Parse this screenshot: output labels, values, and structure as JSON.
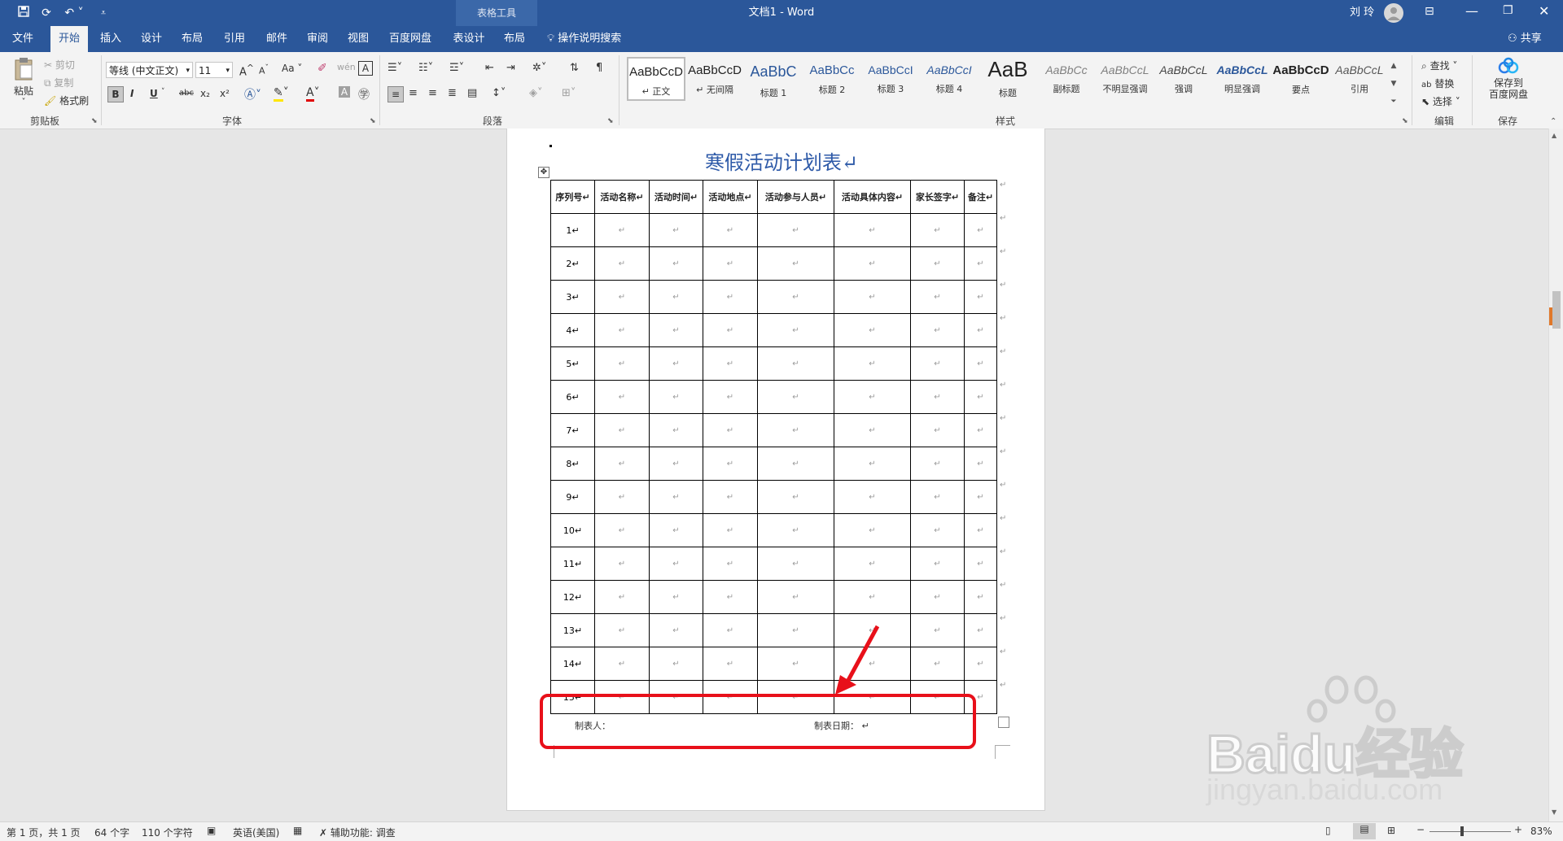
{
  "titlebar": {
    "context_tool": "表格工具",
    "doc_title": "文档1  -  Word",
    "user": "刘 玲",
    "qat": {
      "save_icon": "save-icon",
      "redo_icon": "redo-icon",
      "undo_icon": "undo-icon",
      "customize_icon": "customize-icon"
    }
  },
  "tabs": [
    "文件",
    "开始",
    "插入",
    "设计",
    "布局",
    "引用",
    "邮件",
    "审阅",
    "视图",
    "百度网盘",
    "表设计",
    "布局"
  ],
  "active_tab": "开始",
  "tell_me": "操作说明搜索",
  "share": "共享",
  "ribbon": {
    "clipboard": {
      "paste": "粘贴",
      "cut": "剪切",
      "copy": "复制",
      "format_painter": "格式刷",
      "label": "剪贴板"
    },
    "font": {
      "font_name": "等线 (中文正文)",
      "font_size": "11",
      "label": "字体",
      "bold": "B",
      "italic": "I",
      "underline": "U",
      "strike": "abc",
      "sub": "x₂",
      "sup": "x²"
    },
    "paragraph": {
      "label": "段落"
    },
    "styles": {
      "label": "样式",
      "items": [
        {
          "preview": "AaBbCcD",
          "name": "↵ 正文"
        },
        {
          "preview": "AaBbCcD",
          "name": "↵ 无间隔"
        },
        {
          "preview": "AaBbC",
          "name": "标题 1"
        },
        {
          "preview": "AaBbCc",
          "name": "标题 2"
        },
        {
          "preview": "AaBbCcI",
          "name": "标题 3"
        },
        {
          "preview": "AaBbCcI",
          "name": "标题 4"
        },
        {
          "preview": "AaB",
          "name": "标题"
        },
        {
          "preview": "AaBbCc",
          "name": "副标题"
        },
        {
          "preview": "AaBbCcL",
          "name": "不明显强调"
        },
        {
          "preview": "AaBbCcL",
          "name": "强调"
        },
        {
          "preview": "AaBbCcL",
          "name": "明显强调"
        },
        {
          "preview": "AaBbCcD",
          "name": "要点"
        },
        {
          "preview": "AaBbCcL",
          "name": "引用"
        }
      ]
    },
    "editing": {
      "find": "查找",
      "replace": "替换",
      "select": "选择",
      "label": "编辑"
    },
    "save": {
      "btn_line1": "保存到",
      "btn_line2": "百度网盘",
      "label": "保存"
    }
  },
  "document": {
    "title": "寒假活动计划表↵",
    "headers": [
      "序列号↵",
      "活动名称↵",
      "活动时间↵",
      "活动地点↵",
      "活动参与人员↵",
      "活动具体内容↵",
      "家长签字↵",
      "备注↵"
    ],
    "row_numbers": [
      "1↵",
      "2↵",
      "3↵",
      "4↵",
      "5↵",
      "6↵",
      "7↵",
      "8↵",
      "9↵",
      "10↵",
      "11↵",
      "12↵",
      "13↵",
      "14↵",
      "15↵"
    ],
    "cell_mark": "↵",
    "maker_label": "制表人：",
    "date_label": "制表日期：  ↵"
  },
  "status": {
    "page": "第 1 页，共 1 页",
    "words": "64 个字",
    "chars": "110 个字符",
    "language": "英语(美国)",
    "accessibility": "辅助功能: 调查",
    "zoom": "83%"
  },
  "watermark": {
    "brand": "Baidu经验",
    "url": "jingyan.baidu.com"
  },
  "colors": {
    "accent": "#2b579a",
    "title_blue": "#2e5aa8",
    "highlight_red": "#e8101a"
  }
}
